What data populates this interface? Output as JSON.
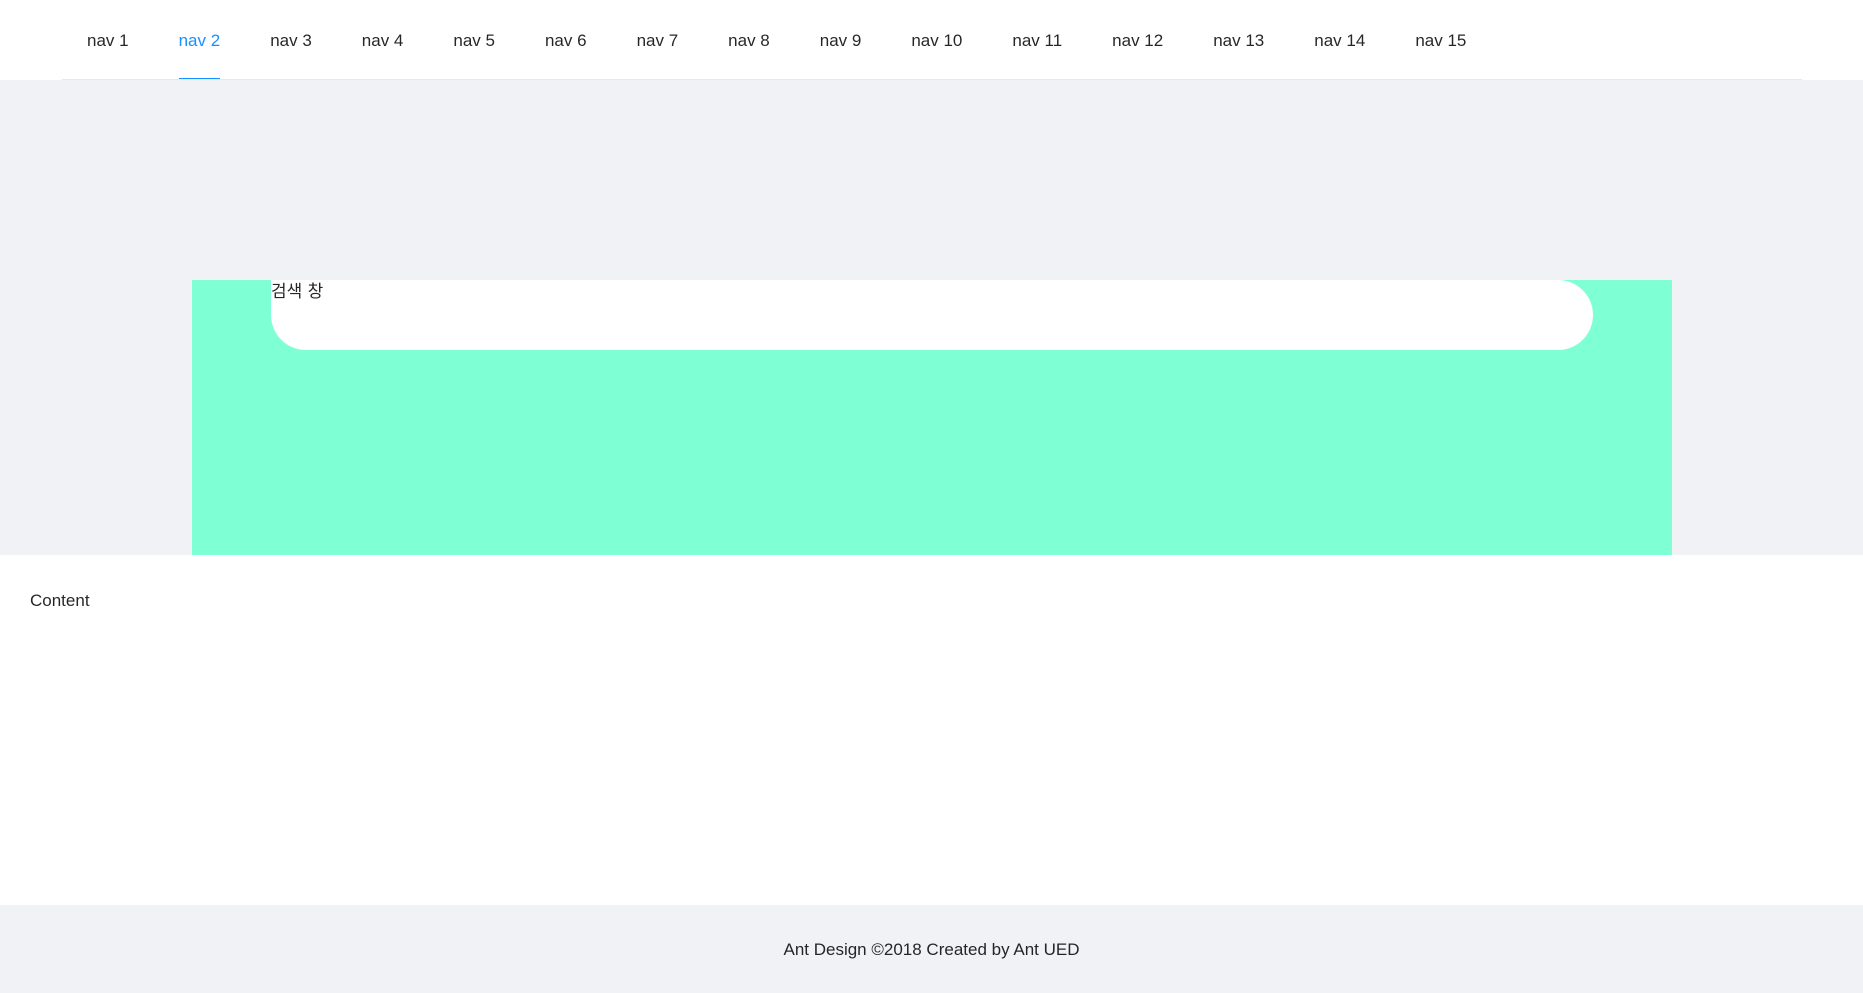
{
  "nav": {
    "items": [
      {
        "label": "nav 1"
      },
      {
        "label": "nav 2",
        "active": true
      },
      {
        "label": "nav 3"
      },
      {
        "label": "nav 4"
      },
      {
        "label": "nav 5"
      },
      {
        "label": "nav 6"
      },
      {
        "label": "nav 7"
      },
      {
        "label": "nav 8"
      },
      {
        "label": "nav 9"
      },
      {
        "label": "nav 10"
      },
      {
        "label": "nav 11"
      },
      {
        "label": "nav 12"
      },
      {
        "label": "nav 13"
      },
      {
        "label": "nav 14"
      },
      {
        "label": "nav 15"
      }
    ],
    "active_color": "#1890ff"
  },
  "hero": {
    "search_label": "검색 창",
    "panel_color": "#7fffd4",
    "background_color": "#f0f2f5"
  },
  "content": {
    "text": "Content"
  },
  "footer": {
    "text": "Ant Design ©2018 Created by Ant UED"
  }
}
